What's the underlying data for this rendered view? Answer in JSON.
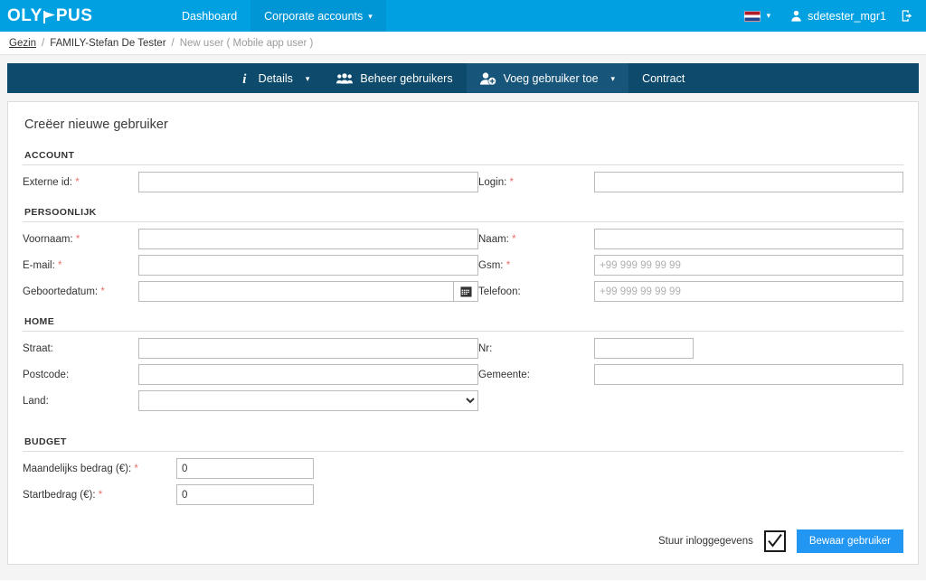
{
  "header": {
    "logo_text_1": "OLY",
    "logo_text_2": "PUS",
    "logo_icon": "olympus-flag-m-icon",
    "nav": [
      {
        "label": "Dashboard",
        "active": false,
        "has_caret": false
      },
      {
        "label": "Corporate accounts",
        "active": true,
        "has_caret": true
      }
    ],
    "language": {
      "flag": "nl-flag-icon",
      "caret": "chevron-down-icon"
    },
    "user": {
      "icon": "user-icon",
      "name": "sdetester_mgr1"
    },
    "logout": {
      "icon": "logout-icon"
    },
    "bg_color": "#00a0e1",
    "active_bg_color": "#0096d6"
  },
  "breadcrumb": {
    "items": [
      {
        "label": "Gezin",
        "type": "link"
      },
      {
        "label": "FAMILY-Stefan De Tester",
        "type": "text"
      },
      {
        "label": "New user ( Mobile app user )",
        "type": "current"
      }
    ],
    "separator": "/"
  },
  "subnav": {
    "bg_color": "#0d4a6b",
    "active_bg_color": "#17557a",
    "items": [
      {
        "label": "Details",
        "icon": "info-icon",
        "caret": true,
        "active": false
      },
      {
        "label": "Beheer gebruikers",
        "icon": "users-icon",
        "caret": false,
        "active": false
      },
      {
        "label": "Voeg gebruiker toe",
        "icon": "user-add-icon",
        "caret": true,
        "active": true
      },
      {
        "label": "Contract",
        "icon": "",
        "caret": false,
        "active": false
      }
    ]
  },
  "form": {
    "title": "Creëer nieuwe gebruiker",
    "sections": {
      "account": {
        "heading": "ACCOUNT",
        "fields": {
          "externe_id": {
            "label": "Externe id:",
            "required": true,
            "value": "",
            "placeholder": ""
          },
          "login": {
            "label": "Login:",
            "required": true,
            "value": "",
            "placeholder": ""
          }
        }
      },
      "persoonlijk": {
        "heading": "PERSOONLIJK",
        "fields": {
          "voornaam": {
            "label": "Voornaam:",
            "required": true,
            "value": "",
            "placeholder": ""
          },
          "naam": {
            "label": "Naam:",
            "required": true,
            "value": "",
            "placeholder": ""
          },
          "email": {
            "label": "E-mail:",
            "required": true,
            "value": "",
            "placeholder": ""
          },
          "gsm": {
            "label": "Gsm:",
            "required": true,
            "value": "",
            "placeholder": "+99 999 99 99 99"
          },
          "geboortedatum": {
            "label": "Geboortedatum:",
            "required": true,
            "value": "",
            "placeholder": "",
            "icon": "calendar-icon"
          },
          "telefoon": {
            "label": "Telefoon:",
            "required": false,
            "value": "",
            "placeholder": "+99 999 99 99 99"
          }
        }
      },
      "home": {
        "heading": "HOME",
        "fields": {
          "straat": {
            "label": "Straat:",
            "required": false,
            "value": "",
            "placeholder": ""
          },
          "nr": {
            "label": "Nr:",
            "required": false,
            "value": "",
            "placeholder": ""
          },
          "postcode": {
            "label": "Postcode:",
            "required": false,
            "value": "",
            "placeholder": ""
          },
          "gemeente": {
            "label": "Gemeente:",
            "required": false,
            "value": "",
            "placeholder": ""
          },
          "land": {
            "label": "Land:",
            "required": false,
            "value": "",
            "options": [
              ""
            ]
          }
        }
      },
      "budget": {
        "heading": "BUDGET",
        "fields": {
          "maandelijks": {
            "label": "Maandelijks bedrag (€):",
            "required": true,
            "value": "0"
          },
          "startbedrag": {
            "label": "Startbedrag (€):",
            "required": true,
            "value": "0"
          }
        }
      }
    },
    "actions": {
      "checkbox_label": "Stuur inloggegevens",
      "checkbox_checked": true,
      "save_label": "Bewaar gebruiker",
      "save_color": "#2196f3"
    }
  }
}
